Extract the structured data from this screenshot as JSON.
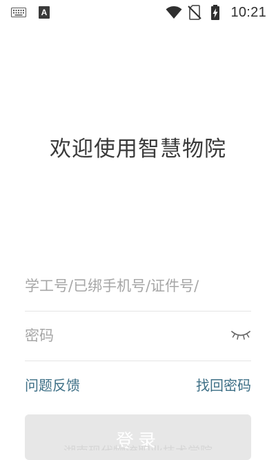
{
  "status_bar": {
    "time": "10:21",
    "a_label": "A",
    "icons": [
      "keyboard-icon",
      "a-notification-icon",
      "wifi-icon",
      "no-sim-icon",
      "battery-charging-icon"
    ]
  },
  "welcome": {
    "title": "欢迎使用智慧物院"
  },
  "form": {
    "account_placeholder": "学工号/已绑手机号/证件号/",
    "password_placeholder": "密码",
    "password_toggle_icon": "eye-closed-icon"
  },
  "links": {
    "feedback": "问题反馈",
    "recover_password": "找回密码"
  },
  "login": {
    "label": "登录"
  },
  "footer": {
    "note": "湖南现代物流职业技术学院"
  },
  "colors": {
    "link": "#3d6f86",
    "button_bg": "#e7e7e7",
    "placeholder": "#a6a6a6",
    "divider": "#e4e4e4"
  }
}
